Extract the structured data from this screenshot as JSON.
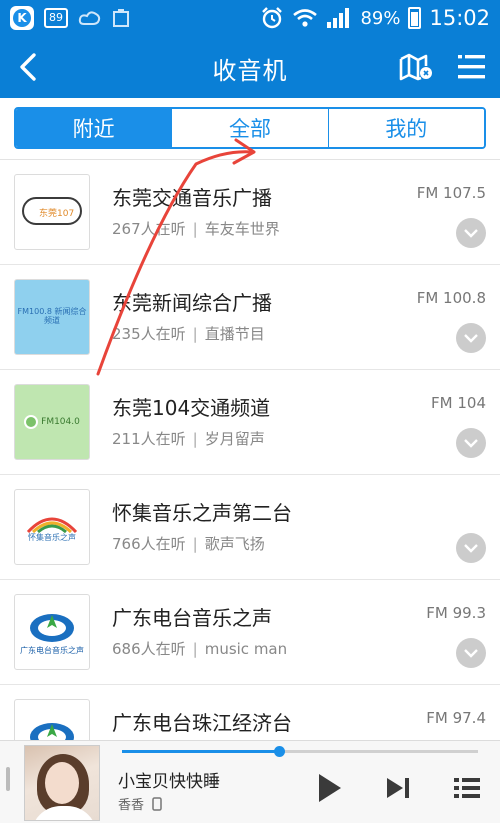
{
  "status_bar": {
    "notification_badge": "89",
    "battery_percent": "89%",
    "time": "15:02",
    "icons": [
      "k-app-icon",
      "cloud-icon",
      "notification-icon",
      "alarm-icon",
      "wifi-icon",
      "signal-icon",
      "battery-icon"
    ]
  },
  "header": {
    "title": "收音机",
    "back_icon": "chevron-left-icon",
    "map_icon": "map-icon",
    "menu_icon": "menu-icon"
  },
  "tabs": [
    {
      "label": "附近",
      "active": true
    },
    {
      "label": "全部",
      "active": false
    },
    {
      "label": "我的",
      "active": false
    }
  ],
  "stations": [
    {
      "name": "东莞交通音乐广播",
      "listeners": "267人在听",
      "program": "车友车世界",
      "frequency": "FM 107.5",
      "logo_text": "东莞107"
    },
    {
      "name": "东莞新闻综合广播",
      "listeners": "235人在听",
      "program": "直播节目",
      "frequency": "FM 100.8",
      "logo_text": "FM100.8 新闻综合频道"
    },
    {
      "name": "东莞104交通频道",
      "listeners": "211人在听",
      "program": "岁月留声",
      "frequency": "FM 104",
      "logo_text": "FM104.0"
    },
    {
      "name": "怀集音乐之声第二台",
      "listeners": "766人在听",
      "program": "歌声飞扬",
      "frequency": "",
      "logo_text": "怀集音乐之声"
    },
    {
      "name": "广东电台音乐之声",
      "listeners": "686人在听",
      "program": "music man",
      "frequency": "FM 99.3",
      "logo_text": "广东电台音乐之声"
    },
    {
      "name": "广东电台珠江经济台",
      "listeners": "",
      "program": "",
      "frequency": "FM 97.4",
      "logo_text": ""
    }
  ],
  "player": {
    "song_title": "小宝贝快快睡",
    "artist": "香香",
    "progress": 0.44,
    "colors": {
      "accent": "#1a8fe8"
    }
  },
  "theme": {
    "primary": "#0a7fd6",
    "accent": "#1a8fe8",
    "annotation": "#e8443a"
  }
}
